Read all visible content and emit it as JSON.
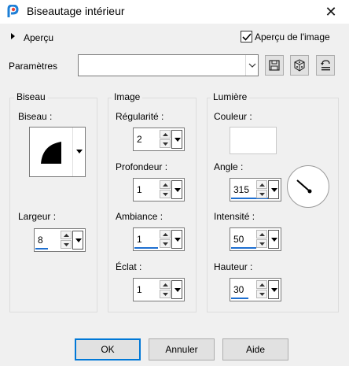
{
  "window": {
    "title": "Biseautage intérieur",
    "close_glyph": "✕",
    "app_icon": "paint-shop-pro-icon"
  },
  "preview_section": {
    "label": "Aperçu",
    "checkbox_label": "Aperçu de l'image",
    "checked": true
  },
  "params": {
    "label": "Paramètres",
    "value": ""
  },
  "toolbar": {
    "icons": [
      "save-preset-icon",
      "random-dice-icon",
      "reset-icon"
    ]
  },
  "groups": {
    "biseau": {
      "title": "Biseau",
      "shape_label": "Biseau :",
      "width_label": "Largeur :",
      "width_value": "8"
    },
    "image": {
      "title": "Image",
      "smoothness_label": "Régularité :",
      "smoothness_value": "2",
      "depth_label": "Profondeur :",
      "depth_value": "1",
      "ambience_label": "Ambiance :",
      "ambience_value": "1",
      "shininess_label": "Éclat :",
      "shininess_value": "1"
    },
    "lumiere": {
      "title": "Lumière",
      "color_label": "Couleur :",
      "color_value": "#ffffff",
      "angle_label": "Angle :",
      "angle_value": "315",
      "intensity_label": "Intensité :",
      "intensity_value": "50",
      "height_label": "Hauteur :",
      "height_value": "30"
    }
  },
  "buttons": {
    "ok": "OK",
    "cancel": "Annuler",
    "help": "Aide"
  },
  "colors": {
    "accent": "#0078d7",
    "slider_underline": "#1e6fd0"
  }
}
